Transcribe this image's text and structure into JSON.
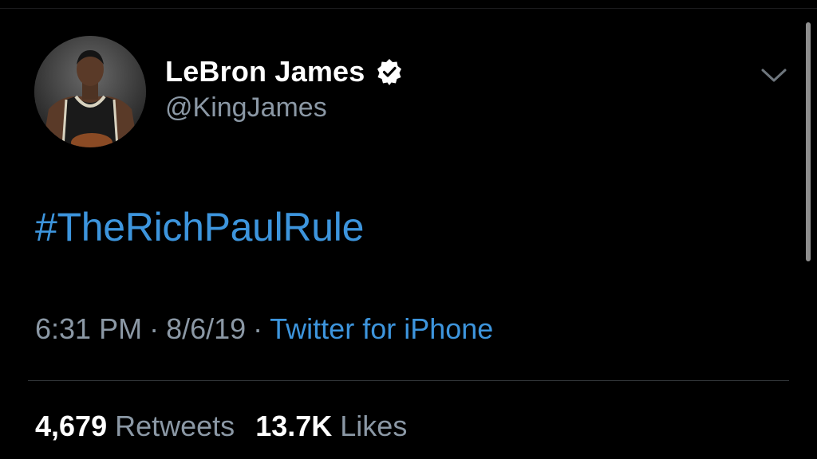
{
  "author": {
    "display_name": "LeBron James",
    "handle": "@KingJames",
    "verified": true
  },
  "tweet": {
    "text": "#TheRichPaulRule"
  },
  "meta": {
    "time": "6:31 PM",
    "separator": "·",
    "date": "8/6/19",
    "source": "Twitter for iPhone"
  },
  "stats": {
    "retweets_count": "4,679",
    "retweets_label": "Retweets",
    "likes_count": "13.7K",
    "likes_label": "Likes"
  },
  "icons": {
    "verified": "verified-badge-icon",
    "caret": "chevron-down-icon"
  },
  "colors": {
    "background": "#000000",
    "link_blue": "#3d95dd",
    "secondary_text": "#8b98a5",
    "primary_text": "#ffffff"
  }
}
